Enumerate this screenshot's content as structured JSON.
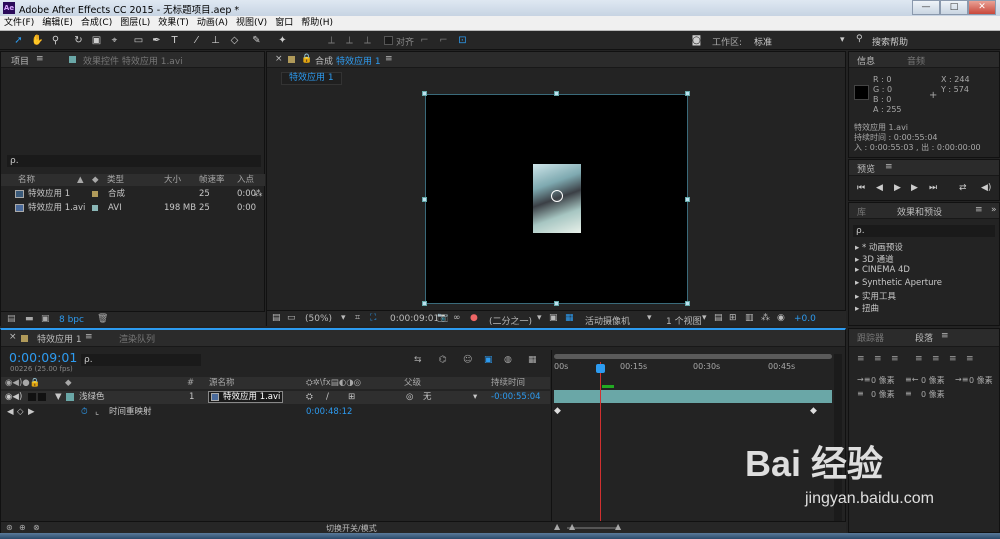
{
  "window": {
    "title": "Adobe After Effects CC 2015 - 无标题项目.aep *",
    "logo": "Ae"
  },
  "menu": [
    "文件(F)",
    "编辑(E)",
    "合成(C)",
    "图层(L)",
    "效果(T)",
    "动画(A)",
    "视图(V)",
    "窗口",
    "帮助(H)"
  ],
  "toolbar": {
    "snap_label": "对齐",
    "workspace_label": "工作区:",
    "workspace_value": "标准",
    "search_help": "搜索帮助"
  },
  "project_panel": {
    "tab": "项目",
    "effects_tab": "效果控件 特效应用 1.avi",
    "search_placeholder": "ρ.",
    "columns": [
      "名称",
      "类型",
      "大小",
      "帧速率",
      "入点"
    ],
    "items": [
      {
        "name": "特效应用 1",
        "type": "合成",
        "size": "",
        "fps": "25",
        "in": "0:00"
      },
      {
        "name": "特效应用 1.avi",
        "type": "AVI",
        "size": "198 MB",
        "fps": "25",
        "in": "0:00"
      }
    ],
    "bpc": "8 bpc"
  },
  "comp_panel": {
    "tab": "合成",
    "comp_name": "特效应用 1",
    "subtab": "特效应用 1",
    "zoom": "(50%)",
    "timecode": "0:00:09:01",
    "resolution": "(二分之一)",
    "camera": "活动摄像机",
    "views": "1 个视图",
    "exposure": "+0.0"
  },
  "info_panel": {
    "tab": "信息",
    "audio_tab": "音频",
    "r": "R : 0",
    "g": "G : 0",
    "b": "B : 0",
    "a": "A : 255",
    "x": "X : 244",
    "y": "Y : 574",
    "clip": "特效应用 1.avi",
    "duration": "持续时间 : 0:00:55:04",
    "in_out": "入 : 0:00:55:03 , 出 : 0:00:00:00"
  },
  "preview_panel": {
    "tab": "预览"
  },
  "effects_panel": {
    "lib_tab": "库",
    "tab": "效果和预设",
    "search": "ρ.",
    "items": [
      "* 动画预设",
      "3D 通道",
      "CINEMA 4D",
      "Synthetic Aperture",
      "实用工具",
      "扭曲"
    ]
  },
  "paragraph_panel": {
    "tracker_tab": "跟踪器",
    "tab": "段落",
    "px": "0 像素"
  },
  "timeline": {
    "tab": "特效应用 1",
    "render_tab": "渲染队列",
    "timecode": "0:00:09:01",
    "frames": "00226 (25.00 fps)",
    "search": "ρ.",
    "col_source": "源名称",
    "col_parent": "父级",
    "col_duration": "持续时间",
    "col_num": "#",
    "layer": {
      "label": "浅绿色",
      "num": "1",
      "source": "特效应用 1.avi",
      "parent": "无",
      "duration": "-0:00:55:04"
    },
    "property": {
      "name": "时间重映射",
      "value": "0:00:48:12"
    },
    "ruler": [
      "00s",
      "00:15s",
      "00:30s",
      "00:45s"
    ],
    "bottom": "切换开关/模式"
  },
  "watermark": {
    "text": "Bai 经验",
    "url": "jingyan.baidu.com"
  },
  "colors": {
    "accent": "#2d9bf0",
    "layer": "#6aa7a7"
  }
}
